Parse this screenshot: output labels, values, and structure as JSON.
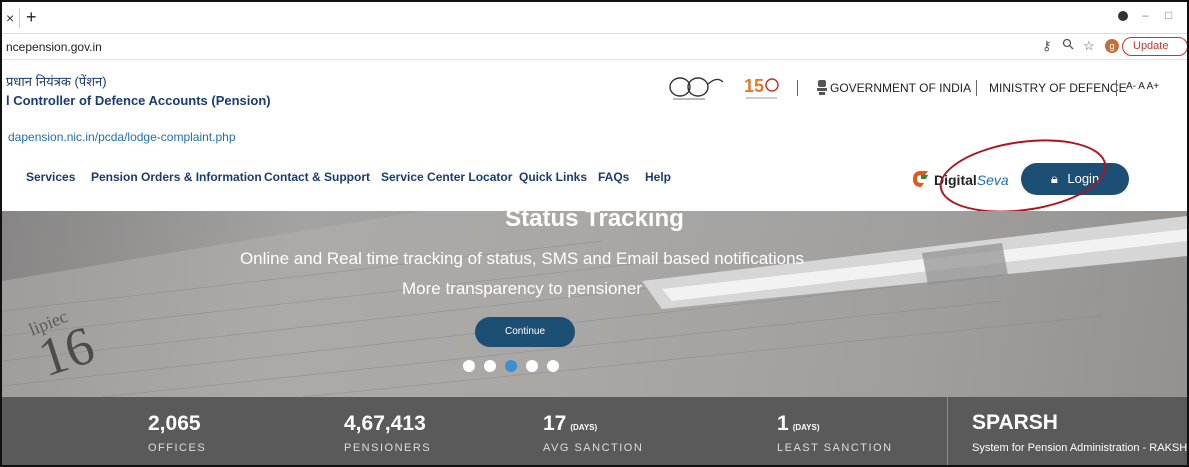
{
  "browser": {
    "tab_close": "×",
    "new_tab": "+",
    "url": "ncepension.gov.in",
    "profile_initial": "g",
    "update_label": "Update",
    "key_icon": "key-icon",
    "zoom_icon": "zoom-icon",
    "star_icon": "star-icon"
  },
  "header": {
    "hindi_name": "प्रधान नियंत्रक (पेंशन)",
    "org_name": "l Controller of Defence Accounts (Pension)",
    "hover_url": "dapension.nic.in/pcda/lodge-complaint.php",
    "gov": "GOVERNMENT OF INDIA",
    "ministry": "MINISTRY OF DEFENCE",
    "font_controls": "A- A A+"
  },
  "nav": {
    "items": [
      "Services",
      "Pension Orders & Information",
      "Contact & Support",
      "Service Center Locator",
      "Quick Links",
      "FAQs",
      "Help"
    ]
  },
  "login": {
    "digital": "Digital",
    "seva": "Seva",
    "label": "Login"
  },
  "hero": {
    "title": "Status Tracking",
    "line1": "Online and Real time tracking of status, SMS and Email based notifications",
    "line2": "More transparency to pensioner",
    "continue": "Continue",
    "slides": 5,
    "active_slide": 3
  },
  "stats": [
    {
      "value": "2,065",
      "unit": "",
      "label": "OFFICES"
    },
    {
      "value": "4,67,413",
      "unit": "",
      "label": "PENSIONERS"
    },
    {
      "value": "17",
      "unit": "(DAYS)",
      "label": "AVG SANCTION"
    },
    {
      "value": "1",
      "unit": "(DAYS)",
      "label": "LEAST SANCTION"
    }
  ],
  "sparsh": {
    "title": "SPARSH",
    "desc": "System for Pension Administration - RAKSHA"
  },
  "colors": {
    "navy": "#1a3c6e",
    "button": "#1d4e74",
    "annotation": "#b0141e",
    "stats_bg": "#5a5a5a"
  }
}
